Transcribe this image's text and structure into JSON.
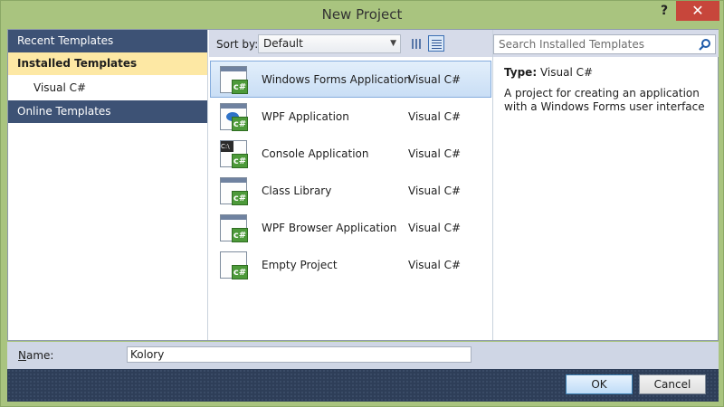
{
  "window": {
    "title": "New Project",
    "help_glyph": "?",
    "close_glyph": "✕"
  },
  "left_pane": {
    "recent": "Recent Templates",
    "installed": "Installed Templates",
    "installed_child": "Visual C#",
    "online": "Online Templates"
  },
  "toolbar": {
    "sort_label": "Sort by:",
    "sort_value": "Default"
  },
  "templates": [
    {
      "name": "Windows Forms Application",
      "lang": "Visual C#"
    },
    {
      "name": "WPF Application",
      "lang": "Visual C#"
    },
    {
      "name": "Console Application",
      "lang": "Visual C#"
    },
    {
      "name": "Class Library",
      "lang": "Visual C#"
    },
    {
      "name": "WPF Browser Application",
      "lang": "Visual C#"
    },
    {
      "name": "Empty Project",
      "lang": "Visual C#"
    }
  ],
  "icon_badge": "c#",
  "search": {
    "placeholder": "Search Installed Templates"
  },
  "details": {
    "type_label": "Type:",
    "type_value": "Visual C#",
    "description": "A project for creating an application with a Windows Forms user interface"
  },
  "name_row": {
    "label_hotkey": "N",
    "label_rest": "ame:",
    "value": "Kolory"
  },
  "buttons": {
    "ok": "OK",
    "cancel": "Cancel"
  }
}
